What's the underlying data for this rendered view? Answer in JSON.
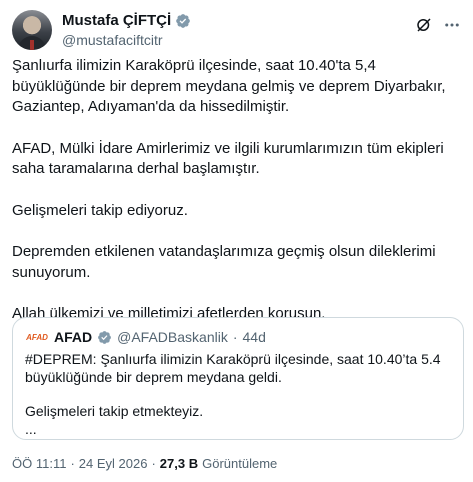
{
  "author": {
    "name": "Mustafa ÇİFTÇİ",
    "handle": "@mustafaciftcitr",
    "verified_color": "#829aab"
  },
  "tweet": {
    "paragraphs": [
      "Şanlıurfa ilimizin Karaköprü ilçesinde, saat 10.40'ta 5,4 büyüklüğünde bir deprem meydana gelmiş ve deprem Diyarbakır, Gaziantep, Adıyaman'da da hissedilmiştir.",
      "AFAD, Mülki İdare Amirlerimiz ve ilgili kurumlarımızın tüm ekipleri saha taramalarına derhal başlamıştır.",
      "Gelişmeleri takip ediyoruz.",
      "Depremden etkilenen vatandaşlarımıza geçmiş olsun dileklerimi sunuyorum.",
      "Allah ülkemizi ve milletimizi afetlerden korusun."
    ]
  },
  "quoted_tweet": {
    "logo_text": "AFAD",
    "name": "AFAD",
    "handle": "@AFADBaskanlik",
    "separator": "·",
    "time": "44d",
    "text_line1": "#DEPREM: Şanlıurfa ilimizin Karaköprü ilçesinde, saat 10.40’ta 5.4 büyüklüğünde bir deprem meydana geldi.",
    "text_line2": "Gelişmeleri takip etmekteyiz.",
    "text_line3": "..."
  },
  "meta": {
    "time": "ÖÖ 11:11",
    "separator1": "·",
    "date": "24 Eyl 2026",
    "separator2": "·",
    "views_count": "27,3 B",
    "views_label": "Görüntüleme"
  },
  "icons": {
    "grok": "grok-icon",
    "more": "more-icon",
    "verified": "verified-badge-icon"
  },
  "colors": {
    "text": "#0f1419",
    "secondary": "#536471",
    "border": "#cfd9de",
    "verified_gray": "#829aab",
    "afad_orange": "#e05a1f"
  }
}
